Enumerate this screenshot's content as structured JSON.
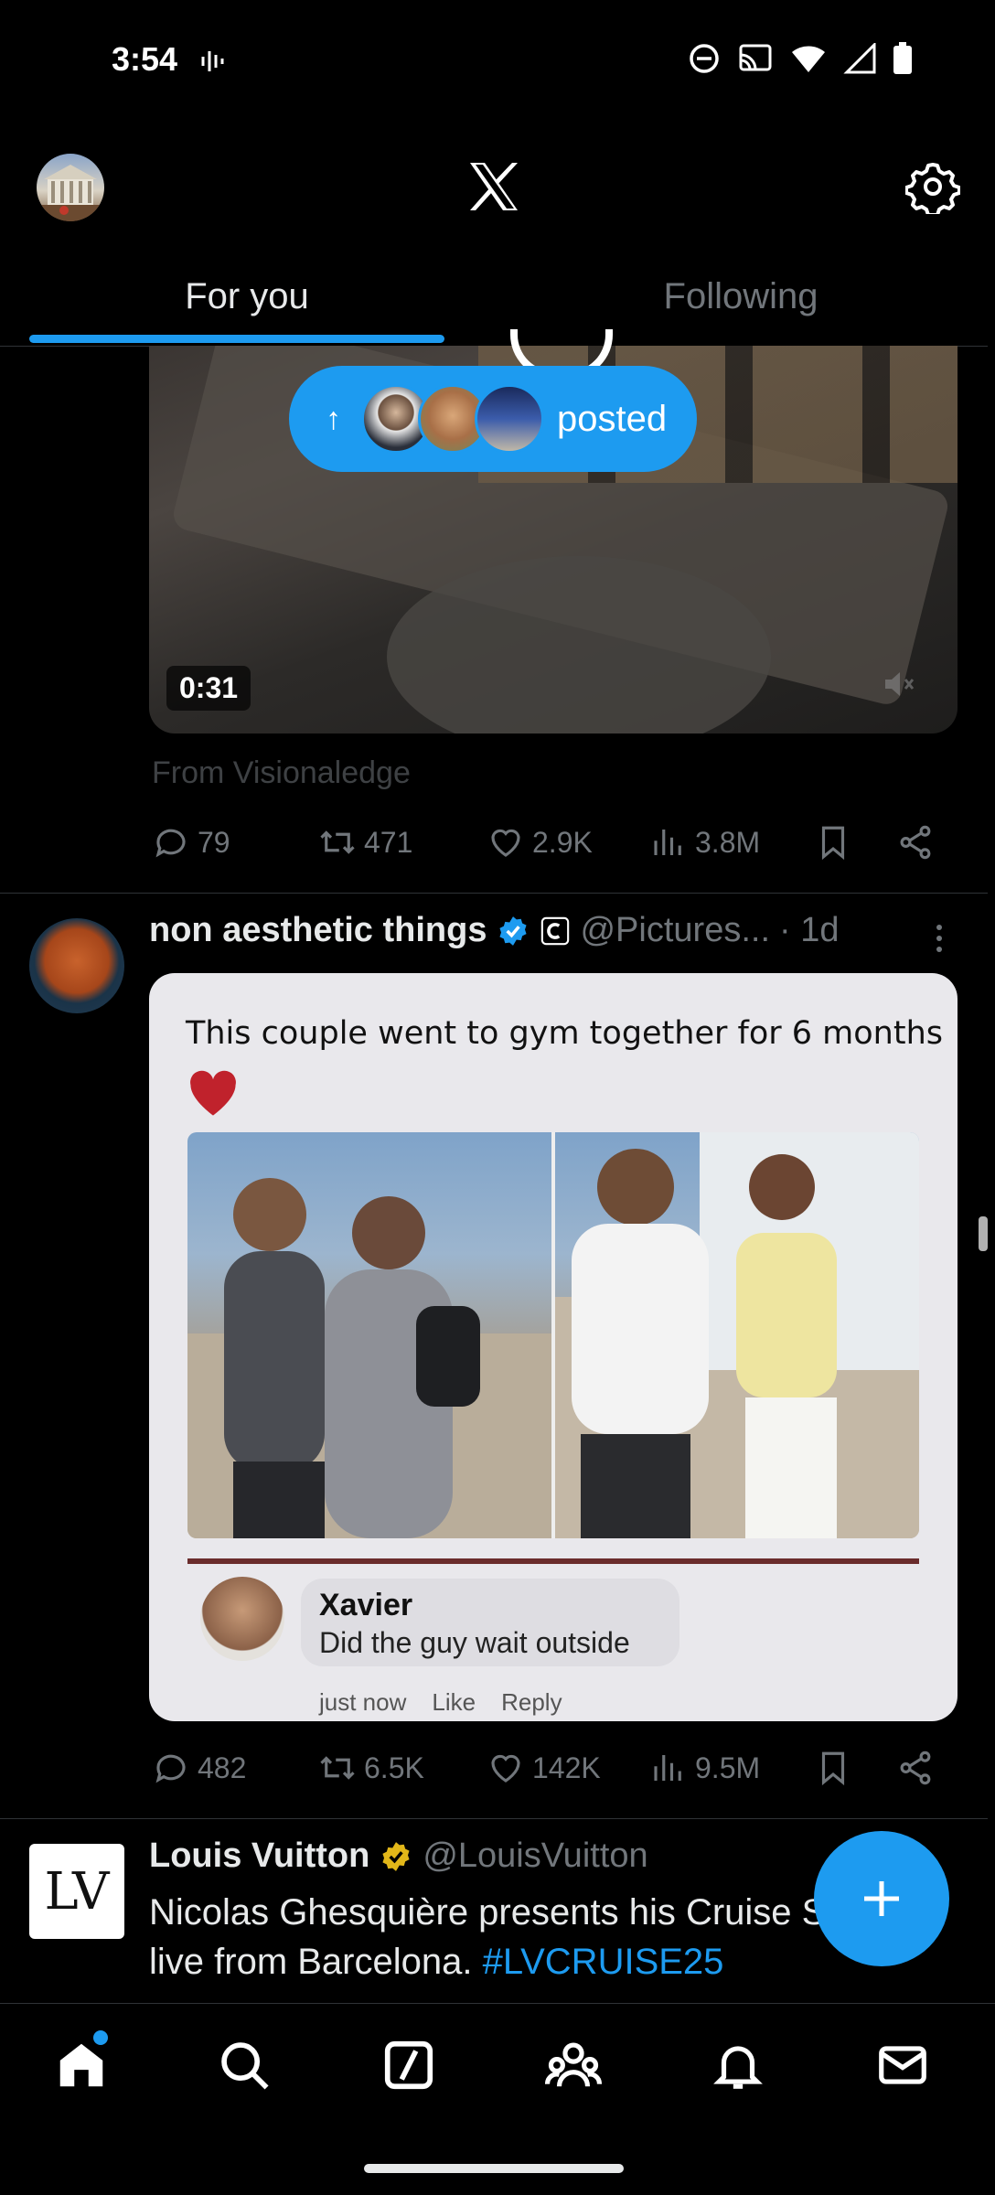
{
  "status_bar": {
    "time": "3:54"
  },
  "header": {
    "logo": "X"
  },
  "tabs": [
    {
      "label": "For you",
      "active": true
    },
    {
      "label": "Following",
      "active": false
    }
  ],
  "new_posts_pill": {
    "label": "posted"
  },
  "tweet1": {
    "video_duration": "0:31",
    "source": "From Visionaledge",
    "replies": "79",
    "reposts": "471",
    "likes": "2.9K",
    "views": "3.8M"
  },
  "tweet2": {
    "name": "non aesthetic things",
    "handle": "@Pictures...",
    "time": "· 1d",
    "image": {
      "caption": "This couple went to gym together for 6 months",
      "comment_name": "Xavier",
      "comment_text": "Did the guy wait outside",
      "comment_time": "just now",
      "comment_like": "Like",
      "comment_reply": "Reply"
    },
    "replies": "482",
    "reposts": "6.5K",
    "likes": "142K",
    "views": "9.5M"
  },
  "tweet3": {
    "name": "Louis Vuitton",
    "handle": "@LouisVuitton",
    "avatar_text": "LV",
    "text": "Nicolas Ghesquière presents his Cruise Show live from Barcelona. ",
    "hashtag": "#LVCRUISE25"
  },
  "colors": {
    "accent": "#1d9bf0",
    "background": "#000000",
    "muted": "#71767b",
    "gold_badge": "#e2b719"
  }
}
